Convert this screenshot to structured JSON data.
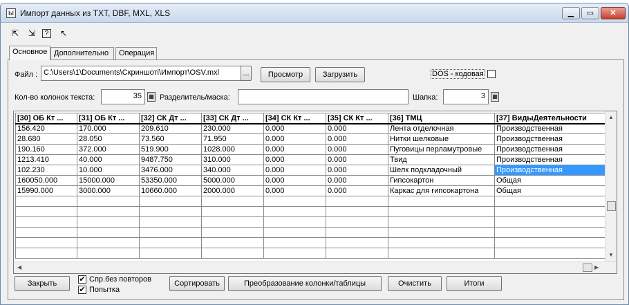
{
  "window": {
    "title": "Импорт данных из TXT, DBF, MXL, XLS",
    "app_icon": "Ы"
  },
  "toolbar": {
    "icons": [
      "export-icon",
      "import-icon",
      "help-icon",
      "pointer-help-icon"
    ],
    "glyphs": [
      "⇱",
      "⇲",
      "?",
      "↖"
    ]
  },
  "tabs": [
    "Основное",
    "Дополнительно",
    "Операция"
  ],
  "form": {
    "file_label": "Файл :",
    "file_value": "C:\\Users\\1\\Documents\\Скриншоті\\Импорт\\OSV.mxl",
    "browse_label": "...",
    "view_button": "Просмотр",
    "load_button": "Загрузить",
    "dos_label": "DOS - кодовая",
    "columns_label": "Кол-во колонок текста:",
    "columns_value": "35",
    "separator_label": "Разделитель/маска:",
    "separator_value": "",
    "header_label": "Шапка:",
    "header_value": "3"
  },
  "table": {
    "headers": [
      "[30] ОБ Кт ...",
      "[31] ОБ Кт ...",
      "[32] СК Дт ...",
      "[33] СК Дт ...",
      "[34] СК Кт ...",
      "[35] СК Кт ...",
      "[36] ТМЦ",
      "[37] ВидыДеятельности"
    ],
    "rows": [
      [
        "156.420",
        "170.000",
        "209.610",
        "230.000",
        "0.000",
        "0.000",
        "Лента отделочная",
        "Производственная"
      ],
      [
        "28.680",
        "28.050",
        "73.560",
        "71.950",
        "0.000",
        "0.000",
        "Нитки шелковые",
        "Производственная"
      ],
      [
        "190.160",
        "372.000",
        "519.900",
        "1028.000",
        "0.000",
        "0.000",
        "Пуговицы перламутровые",
        "Производственная"
      ],
      [
        "1213.410",
        "40.000",
        "9487.750",
        "310.000",
        "0.000",
        "0.000",
        "Твид",
        "Производственная"
      ],
      [
        "102.230",
        "10.000",
        "3476.000",
        "340.000",
        "0.000",
        "0.000",
        "Шелк подкладочный",
        "Производственная"
      ],
      [
        "160050.000",
        "15000.000",
        "53350.000",
        "5000.000",
        "0.000",
        "0.000",
        "Гипсокартон",
        "Общая"
      ],
      [
        "15990.000",
        "3000.000",
        "10660.000",
        "2000.000",
        "0.000",
        "0.000",
        "Каркас для гипсокартона",
        "Общая"
      ]
    ],
    "selected_row": 4,
    "selected_col": 7
  },
  "bottom": {
    "close_button": "Закрыть",
    "no_repeat_label": "Спр.без повторов",
    "attempt_label": "Попытка",
    "sort_button": "Сортировать",
    "transform_button": "Преобразование колонки/таблицы",
    "clear_button": "Очистить",
    "totals_button": "Итоги"
  },
  "colors": {
    "selection": "#3399ff",
    "close_button": "#c8412c"
  }
}
